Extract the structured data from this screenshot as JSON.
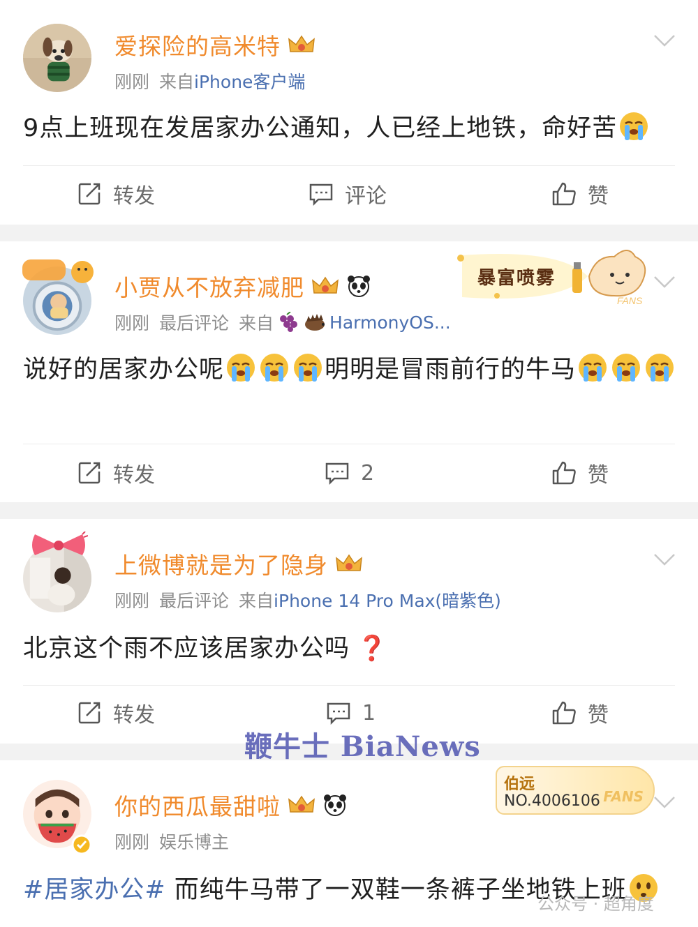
{
  "posts": [
    {
      "username": "爱探险的高米特",
      "time": "刚刚",
      "meta_mid": "",
      "source_prefix": "来自",
      "source": "iPhone客户端",
      "content": "9点上班现在发居家办公通知，人已经上地铁，命好苦",
      "actions": {
        "repost": "转发",
        "comment": "评论",
        "like": "赞"
      }
    },
    {
      "username": "小贾从不放弃减肥",
      "time": "刚刚",
      "meta_mid": "最后评论",
      "source_prefix": "来自",
      "source": "HarmonyOS...",
      "content_a": "说好的居家办公呢",
      "content_b": "明明是冒雨前行的牛马",
      "sticker_text": "暴富喷雾",
      "actions": {
        "repost": "转发",
        "comment": "2",
        "like": "赞"
      }
    },
    {
      "username": "上微博就是为了隐身",
      "time": "刚刚",
      "meta_mid": "最后评论",
      "source_prefix": "来自",
      "source": "iPhone 14 Pro Max(暗紫色)",
      "content": "北京这个雨不应该居家办公吗",
      "actions": {
        "repost": "转发",
        "comment": "1",
        "like": "赞"
      }
    },
    {
      "username": "你的西瓜最甜啦",
      "time": "刚刚",
      "meta_mid": "娱乐博主",
      "hashtag": "#居家办公#",
      "content": "而纯牛马带了一双鞋一条裤子坐地铁上班",
      "fans_name": "伯远",
      "fans_no": "NO.4006106",
      "fans_tag": "FANS"
    }
  ],
  "watermark": "鞭牛士 BiaNews",
  "watermark2": "公众号 · 超角度",
  "colors": {
    "username": "#f08a2c",
    "link": "#4a6fb0",
    "meta": "#8f8f8f",
    "separator": "#f2f2f2"
  }
}
